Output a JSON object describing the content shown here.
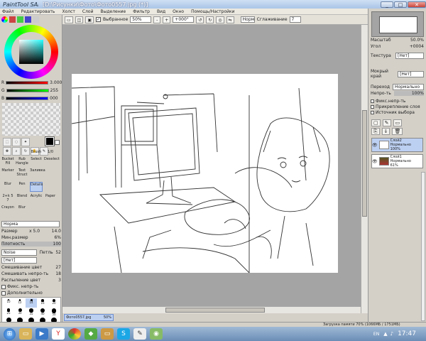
{
  "app": {
    "logo": "PaintTool SAI",
    "title": "[D:\\Рисунки\\Фото\\Фото0557.jpg (*)]"
  },
  "window_controls": [
    "_",
    "□",
    "✕"
  ],
  "menu": [
    "Файл",
    "Редактировать",
    "Холст",
    "Слой",
    "Выделение",
    "Фильтр",
    "Вид",
    "Окно",
    "Помощь/Настройки"
  ],
  "toolbar": {
    "selected_label": "Выбранное",
    "zoom_value": "50%",
    "angle_value": "+000°",
    "mode_value": "Норм",
    "stabilizer_label": "Сглаживание",
    "stabilizer_value": "7"
  },
  "left": {
    "rgb_values": {
      "r": "3.000",
      "g": "255",
      "b": "000"
    },
    "tools": [
      "Brush",
      "1/0",
      "Bucket Fill",
      "Rub Hangle",
      "Select",
      "Deselect",
      "Marker",
      "Text Struct",
      "Заливка",
      "Blur",
      "Pen",
      "Blur",
      "Details",
      "2+k 5 7",
      "Blend",
      "Acrylic",
      "Paper",
      "Crayon",
      "Blur"
    ],
    "mode_select": "Норма",
    "size_label": "Размер",
    "size_mult": "x 5.0",
    "size_value": "14.0",
    "min_size_label": "Мин.размер",
    "min_size_value": "6%",
    "density_label": "Плотность",
    "density_value": "100",
    "noise_select": "Noise",
    "noise_extra": "Петль",
    "noise_value": "52",
    "texture_select": "[Нет]",
    "blend_label": "Смешивание цвет",
    "blend_value": "27",
    "mix_label": "Смешивать непро-ть",
    "mix_value": "18",
    "dilution_label": "Распыление цвет",
    "dilution_value": "3",
    "fix_label": "Фикс. непр-ть",
    "extra_label": "Дополнительно",
    "brush_sizes": [
      "10",
      "12",
      "14",
      "16",
      "20",
      "25",
      "30",
      "35",
      "40",
      "50",
      "60",
      "70",
      "80",
      "100",
      "120"
    ]
  },
  "right": {
    "scale_label": "Масштаб",
    "scale_value": "50.0%",
    "angle_label": "Угол",
    "angle_value": "+0004",
    "texture_label": "Текстура",
    "texture_value": "[Нет]",
    "wet_label": "Мокрый край",
    "wet_value": "[Нет]",
    "transition_label": "Переход",
    "transition_value": "Нормально",
    "opacity_label": "Непро-ть",
    "opacity_value": "100%",
    "checks": [
      "Фикс.непр-ть",
      "Прикрепление слоя",
      "Источник выбора"
    ],
    "layers": [
      {
        "name": "Слой2",
        "mode": "Нормально",
        "opacity": "100%"
      },
      {
        "name": "Слой1",
        "mode": "Нормально",
        "opacity": "61%"
      }
    ]
  },
  "doc_tab": {
    "name": "Фото0557.jpg",
    "zoom": "50%"
  },
  "status": {
    "memory": "Загрузка памяти 70% (1066МБ / 1751МБ)",
    "keys": "Shift Ctrl Alt SPC"
  },
  "taskbar": {
    "time": "17:47",
    "lang": "EN"
  },
  "colors": {
    "canvas_bg": "#a4a4a4",
    "paper": "#ffffff",
    "selected_layer": "#bcd0f2",
    "accent": "#6b8db5"
  }
}
